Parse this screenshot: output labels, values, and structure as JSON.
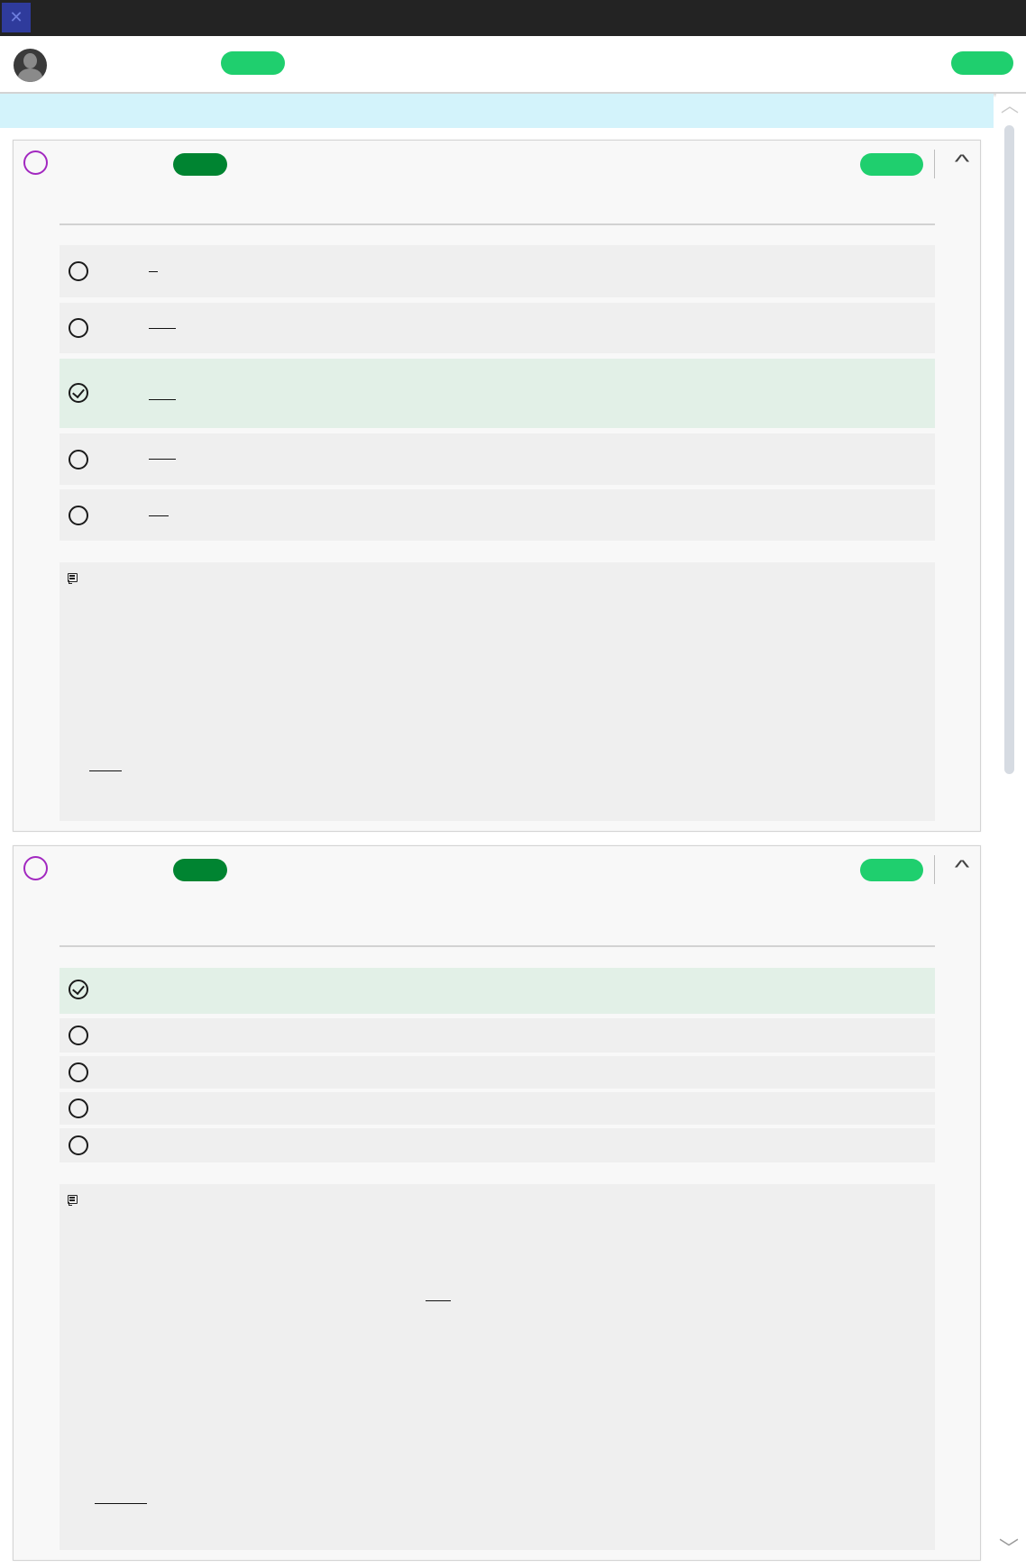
{
  "window": {
    "title": ""
  },
  "topbar": {
    "center_pill_label": "",
    "right_pill_label": ""
  },
  "banner": {
    "text": ""
  },
  "questions": [
    {
      "status_badge": "",
      "right_badge": "",
      "prompt": "",
      "options": [
        {
          "text": "",
          "state": "unselected"
        },
        {
          "text": "",
          "state": "unselected"
        },
        {
          "text": "",
          "state": "correct"
        },
        {
          "text": "",
          "state": "unselected"
        },
        {
          "text": "",
          "state": "unselected"
        }
      ],
      "explanation": ""
    },
    {
      "status_badge": "",
      "right_badge": "",
      "prompt": "",
      "options": [
        {
          "text": "",
          "state": "correct"
        },
        {
          "text": "",
          "state": "unselected"
        },
        {
          "text": "",
          "state": "unselected"
        },
        {
          "text": "",
          "state": "unselected"
        },
        {
          "text": "",
          "state": "unselected"
        }
      ],
      "explanation": ""
    }
  ],
  "colors": {
    "titlebar": "#232323",
    "banner": "#d3f3fb",
    "pill_light": "#1fcf6e",
    "pill_dark": "#008431",
    "question_circle": "#a228c0",
    "correct_option_bg": "#e2f0e7",
    "option_bg": "#efefef"
  },
  "icons": {
    "app": "app-logo-icon",
    "avatar": "user-avatar-icon",
    "collapse": "chevron-up-icon",
    "note": "note-icon",
    "correct": "check-circle-icon",
    "radio": "radio-empty-icon"
  }
}
